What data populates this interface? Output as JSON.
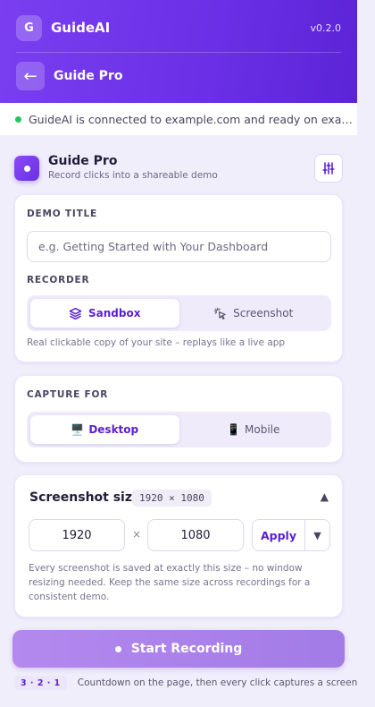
{
  "header": {
    "logo_letter": "G",
    "brand": "GuideAI",
    "version": "v0.2.0",
    "back_arrow": "←",
    "page_title": "Guide Pro"
  },
  "status": {
    "text": "GuideAI is connected to example.com and ready on example.com",
    "color": "#22c55e"
  },
  "section": {
    "title": "Guide Pro",
    "subtitle": "Record clicks into a shareable demo"
  },
  "demo": {
    "title_label": "DEMO TITLE",
    "title_placeholder": "e.g. Getting Started with Your Dashboard",
    "title_value": "",
    "recorder_label": "RECORDER",
    "recorder_options": [
      "Sandbox",
      "Screenshot"
    ],
    "recorder_selected": "Sandbox",
    "recorder_hint": "Real clickable copy of your site – replays like a live app"
  },
  "capture": {
    "label": "CAPTURE FOR",
    "desktop_emoji": "🖥️",
    "desktop": "Desktop",
    "mobile_emoji": "📱",
    "mobile": "Mobile",
    "selected": "Desktop"
  },
  "screenshot_size": {
    "title": "Screenshot size",
    "badge": "1920 × 1080",
    "collapse_glyph": "▲",
    "width": "1920",
    "times": "×",
    "height": "1080",
    "apply": "Apply",
    "apply_caret": "▼",
    "description": "Every screenshot is saved at exactly this size – no window resizing needed. Keep the same size across recordings for a consistent demo."
  },
  "record": {
    "button": "Start Recording",
    "countdown_badge": "3 · 2 · 1",
    "countdown_text": "Countdown on the page, then every click captures a screen"
  },
  "icons": {
    "brand": "logo-icon",
    "back": "back-arrow-icon",
    "status": "status-dot-icon",
    "section": "record-dot-icon",
    "settings": "sliders-icon",
    "sandbox": "layers-icon",
    "screenshot": "pointer-click-icon",
    "desktop": "desktop-icon",
    "mobile": "mobile-icon",
    "collapse": "chevron-up-icon",
    "dropdown": "chevron-down-icon"
  },
  "colors": {
    "accent": "#6a2fe6",
    "accent_text": "#5a1fd3",
    "record_button": "#ad83eb"
  }
}
